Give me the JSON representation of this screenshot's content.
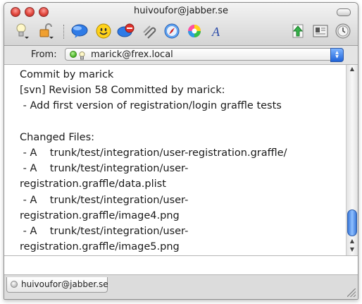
{
  "window": {
    "title": "huivoufor@jabber.se"
  },
  "toolbar": {
    "icons": [
      "status-bulb-icon",
      "lock-icon",
      "chat-bubble-icon",
      "smiley-icon",
      "block-icon",
      "attach-icon",
      "safari-icon",
      "color-wheel-icon",
      "font-icon",
      "send-file-icon",
      "info-icon",
      "history-icon"
    ]
  },
  "from_bar": {
    "label": "From:",
    "value": "marick@frex.local"
  },
  "message": {
    "lines": [
      "Commit by marick",
      "[svn] Revision 58 Committed by marick:",
      " - Add first version of registration/login graffle tests",
      "",
      "Changed Files:",
      " - A    trunk/test/integration/user-registration.graffle/",
      " - A    trunk/test/integration/user-",
      "registration.graffle/data.plist",
      " - A    trunk/test/integration/user-",
      "registration.graffle/image4.png",
      " - A    trunk/test/integration/user-",
      "registration.graffle/image5.png"
    ]
  },
  "input": {
    "value": ""
  },
  "tabs": [
    {
      "label": "huivoufor@jabber.se"
    }
  ],
  "colors": {
    "accent_blue": "#2a6ee0",
    "status_green": "#42b020",
    "close_red": "#e0463c"
  }
}
